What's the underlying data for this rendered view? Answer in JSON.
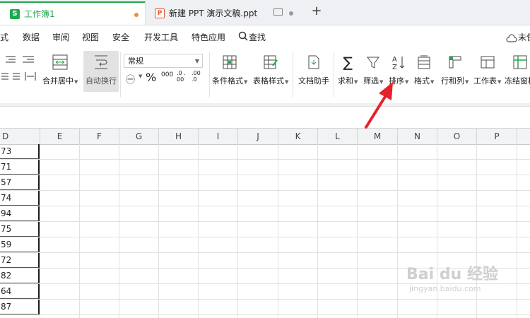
{
  "tabs": [
    {
      "badge": "S",
      "title": "工作簿1"
    },
    {
      "badge": "P",
      "title": "新建 PPT 演示文稿.ppt"
    }
  ],
  "menu": [
    "式",
    "数据",
    "审阅",
    "视图",
    "安全",
    "开发工具",
    "特色应用",
    "查找"
  ],
  "menu_right": "未保",
  "ribbon": {
    "merge_center": "合并居中",
    "wrap_text": "自动换行",
    "number_format": "常规",
    "percent": "%",
    "thousands": "000",
    "dec_increase": ".0 .00",
    "dec_decrease": ".00 .0",
    "cond_format": "条件格式",
    "table_style": "表格样式",
    "doc_assistant": "文档助手",
    "sum": "求和",
    "filter": "筛选",
    "sort": "排序",
    "format": "格式",
    "row_col": "行和列",
    "worksheet": "工作表",
    "freeze": "冻结窗格"
  },
  "columns": [
    "D",
    "E",
    "F",
    "G",
    "H",
    "I",
    "J",
    "K",
    "L",
    "M",
    "N",
    "O",
    "P"
  ],
  "rows": [
    "73",
    "71",
    "57",
    "74",
    "94",
    "75",
    "59",
    "72",
    "82",
    "64",
    "87"
  ],
  "watermark": {
    "main": "Bai du 经验",
    "sub": "jingyan.baidu.com"
  },
  "colors": {
    "green": "#1fa84f",
    "ppt": "#e5522d",
    "arrow": "#e8202a"
  }
}
